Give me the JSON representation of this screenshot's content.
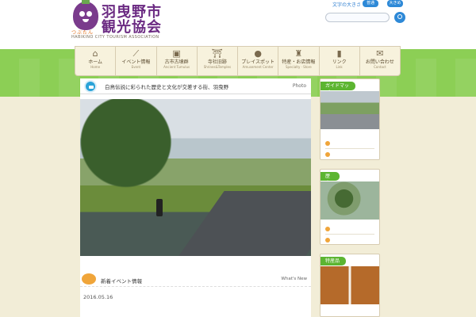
{
  "brand": {
    "title_line1": "羽曳野市",
    "title_line2": "観光協会",
    "mascot_name": "つぶたん",
    "subtitle": "HABIKINO CITY TOURISM ASSOCIATION"
  },
  "text_size": {
    "label": "文字の大きさ",
    "normal": "普通",
    "large": "大きめ"
  },
  "search": {
    "placeholder": ""
  },
  "nav": [
    {
      "label": "ホーム",
      "sub": "Home",
      "icon": "home-icon"
    },
    {
      "label": "イベント情報",
      "sub": "Event",
      "icon": "carrot-icon"
    },
    {
      "label": "古市古墳群",
      "sub": "Ancient Tumulus",
      "icon": "tumulus-icon"
    },
    {
      "label": "寺社旧跡",
      "sub": "Shrines&Temples",
      "icon": "torii-icon"
    },
    {
      "label": "プレイスポット",
      "sub": "Amusement Center",
      "icon": "ball-icon"
    },
    {
      "label": "特産・お店情報",
      "sub": "Specialty · Store",
      "icon": "wine-icon"
    },
    {
      "label": "リンク",
      "sub": "Link",
      "icon": "bottle-icon"
    },
    {
      "label": "お問い合わせ",
      "sub": "Contact",
      "icon": "mail-icon"
    }
  ],
  "main": {
    "headline": "白鳥伝説に彩られた歴史と文化が交差する街、羽曳野",
    "headline_tag": "Photo",
    "news_title": "新着イベント情報",
    "news_tag": "What's New",
    "news_date": "2016.05.16"
  },
  "side": {
    "card1": {
      "label": "ガイドマップ"
    },
    "card2": {
      "label": "歴 史"
    },
    "card3": {
      "label": "特産品"
    }
  }
}
